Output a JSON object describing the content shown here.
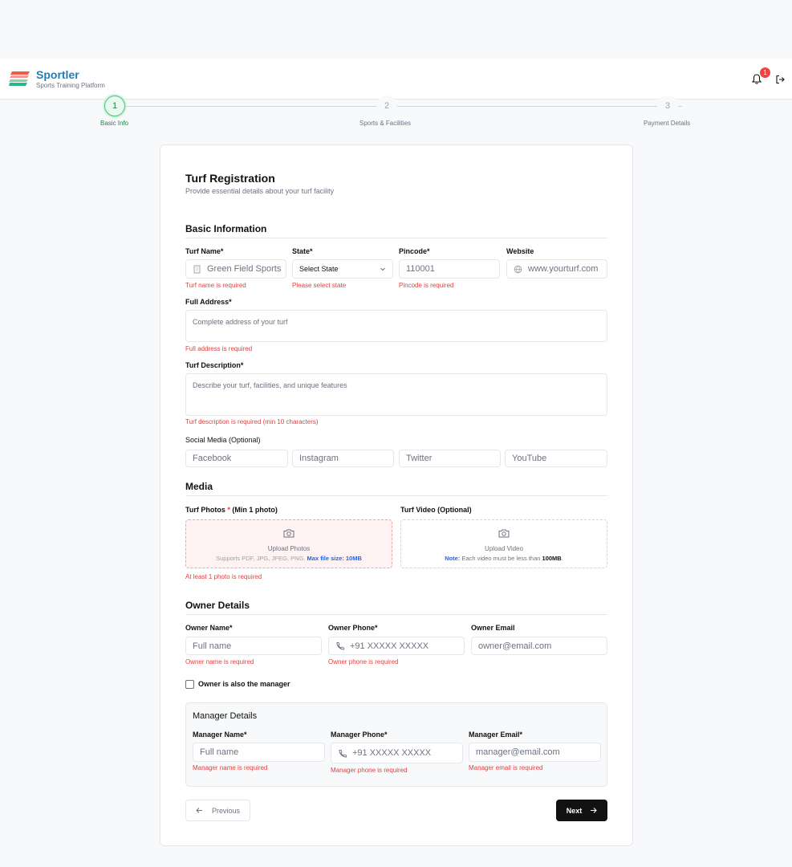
{
  "app": {
    "name": "Sportler",
    "tagline": "Sports Training Platform",
    "notification_count": "1"
  },
  "steps": [
    {
      "number": "1",
      "label": "Basic Info"
    },
    {
      "number": "2",
      "label": "Sports & Facilities"
    },
    {
      "number": "3",
      "label": "Payment Details"
    }
  ],
  "form": {
    "title": "Turf Registration",
    "subtitle": "Provide essential details about your turf facility",
    "basic": {
      "heading": "Basic Information",
      "turf_name": {
        "label": "Turf Name*",
        "placeholder": "Green Field Sports",
        "error": "Turf name is required"
      },
      "state": {
        "label": "State*",
        "value": "Select State",
        "error": "Please select state"
      },
      "pincode": {
        "label": "Pincode*",
        "placeholder": "110001",
        "error": "Pincode is required"
      },
      "website": {
        "label": "Website",
        "placeholder": "www.yourturf.com"
      },
      "address": {
        "label": "Full Address*",
        "placeholder": "Complete address of your turf",
        "error": "Full address is required"
      },
      "description": {
        "label": "Turf Description*",
        "placeholder": "Describe your turf, facilities, and unique features",
        "error": "Turf description is required (min 10 characters)"
      },
      "social": {
        "label": "Social Media (Optional)",
        "facebook": "Facebook",
        "instagram": "Instagram",
        "twitter": "Twitter",
        "youtube": "YouTube"
      }
    },
    "media": {
      "heading": "Media",
      "photos_label_pre": "Turf Photos",
      "photos_star": "*",
      "photos_label_post": "(Min 1 photo)",
      "photos_title": "Upload Photos",
      "photos_sub": "Supports PDF, JPG, JPEG, PNG.",
      "photos_limit": "Max file size: 10MB",
      "photos_error": "At least 1 photo is required",
      "video_label": "Turf Video (Optional)",
      "video_title": "Upload Video",
      "video_note": "Note:",
      "video_sub": "Each video must be less than",
      "video_limit": "100MB",
      "video_dot": "."
    },
    "owner": {
      "heading": "Owner Details",
      "name": {
        "label": "Owner Name*",
        "placeholder": "Full name",
        "error": "Owner name is required"
      },
      "phone": {
        "label": "Owner Phone*",
        "placeholder": "+91 XXXXX XXXXX",
        "error": "Owner phone is required"
      },
      "email": {
        "label": "Owner Email",
        "placeholder": "owner@email.com"
      },
      "is_manager": "Owner is also the manager"
    },
    "manager": {
      "heading": "Manager Details",
      "name": {
        "label": "Manager Name*",
        "placeholder": "Full name",
        "error": "Manager name is required"
      },
      "phone": {
        "label": "Manager Phone*",
        "placeholder": "+91 XXXXX XXXXX",
        "error": "Manager phone is required"
      },
      "email": {
        "label": "Manager Email*",
        "placeholder": "manager@email.com",
        "error": "Manager email is required"
      }
    },
    "prev_label": "Previous",
    "next_label": "Next"
  },
  "colors": {
    "brand": "#1f7db8",
    "active_step": "#16884a",
    "error": "#e53e3e",
    "primary_button": "#111111"
  }
}
